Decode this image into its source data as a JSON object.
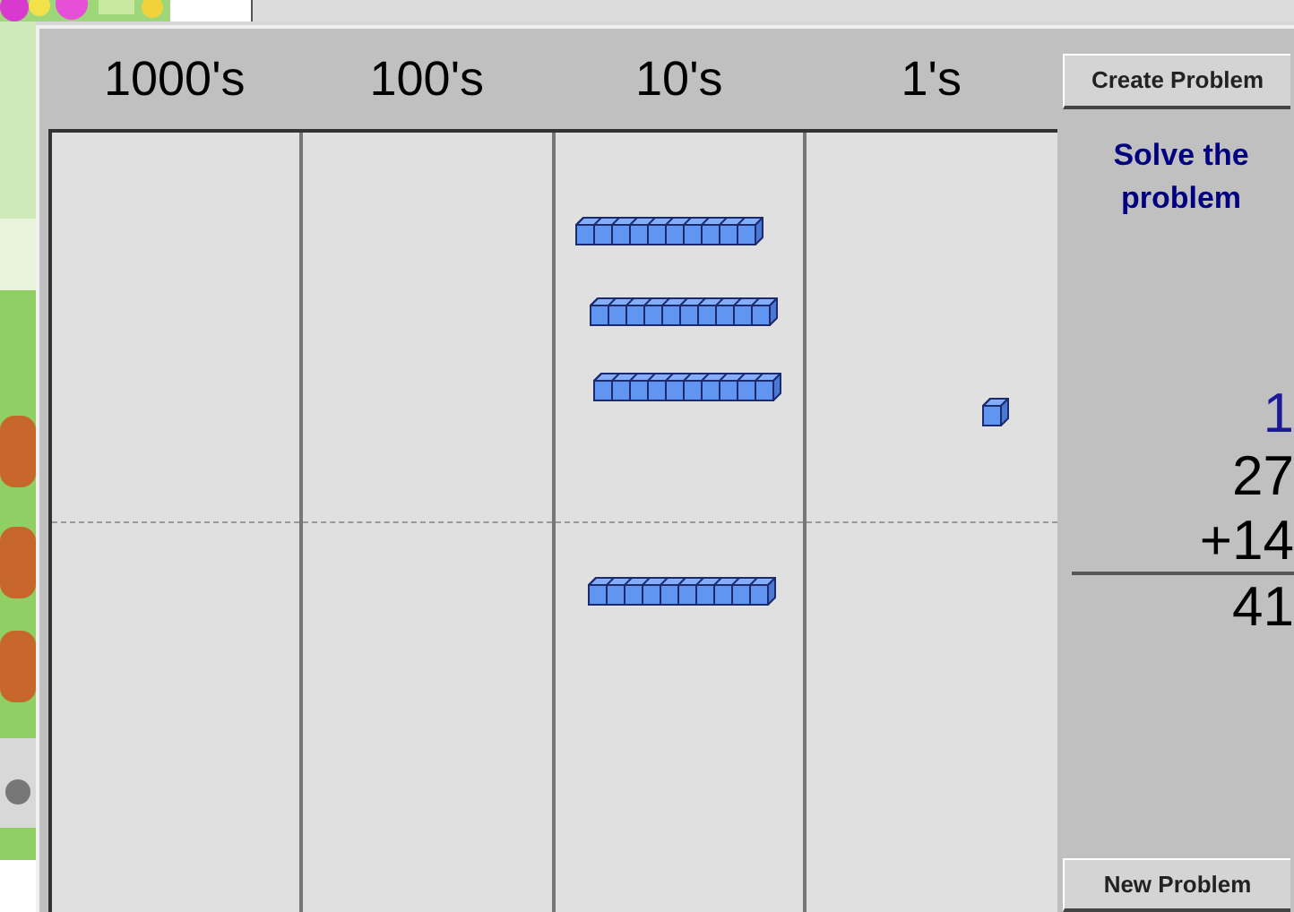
{
  "board": {
    "columns": [
      {
        "heading": "1000's"
      },
      {
        "heading": "100's"
      },
      {
        "heading": "10's",
        "top_blocks": [
          {
            "kind": "rod"
          },
          {
            "kind": "rod"
          },
          {
            "kind": "rod"
          }
        ],
        "bottom_blocks": [
          {
            "kind": "rod"
          }
        ]
      },
      {
        "heading": "1's",
        "top_blocks": [
          {
            "kind": "unit"
          }
        ]
      }
    ]
  },
  "panel": {
    "create_button": "Create Problem",
    "instruction": "Solve the problem",
    "carry": "1",
    "addends": [
      "27",
      "+14"
    ],
    "answer": "41",
    "new_button": "New Problem"
  }
}
